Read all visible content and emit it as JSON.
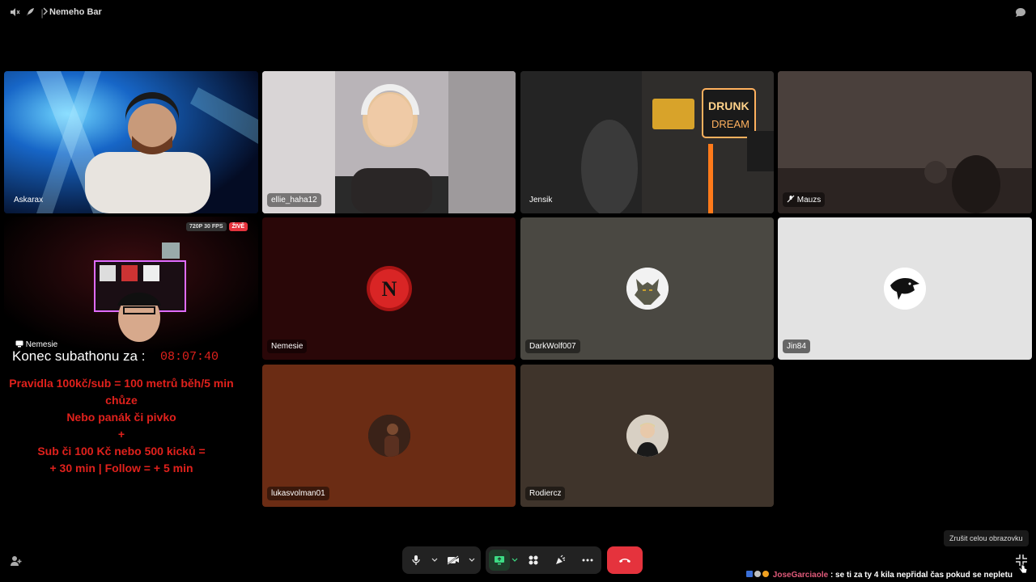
{
  "topbar": {
    "title": "Nemeho Bar"
  },
  "tiles": [
    {
      "name": "Askarax"
    },
    {
      "name": "ellie_haha12"
    },
    {
      "name": "Jensik"
    },
    {
      "name": "Mauzs"
    },
    {
      "name": "Nemesie"
    },
    {
      "name": "DarkWolf007"
    },
    {
      "name": "Jin84"
    },
    {
      "name": "lukasvolman01"
    },
    {
      "name": "Rodiercz"
    }
  ],
  "stream": {
    "name": "Nemesie",
    "quality": "720P 30 FPS",
    "live": "ŽIVĚ",
    "subathon_label": "Konec subathonu za :",
    "timer": "08:07:40",
    "rules": [
      "Pravidla 100kč/sub = 100 metrů běh/5 min chůze",
      "Nebo panák či pivko",
      "+",
      "Sub či 100 Kč nebo 500 kicků =",
      "+ 30 min | Follow = + 5 min"
    ]
  },
  "tooltip": "Zrušit celou obrazovku",
  "chat": {
    "user": "JoseGarciaole",
    "message": ": se ti za ty 4 kila nepřidal čas pokud se nepletu"
  },
  "colors": {
    "end_call": "#e5333d",
    "screen_share_active": "#1f3d2a",
    "nemesie_tile": "#2a0708",
    "darkwolf_tile": "#4a4842",
    "jin_tile": "#e3e3e3",
    "lukas_tile": "#6b2c14",
    "rodier_tile": "#3f342b"
  }
}
